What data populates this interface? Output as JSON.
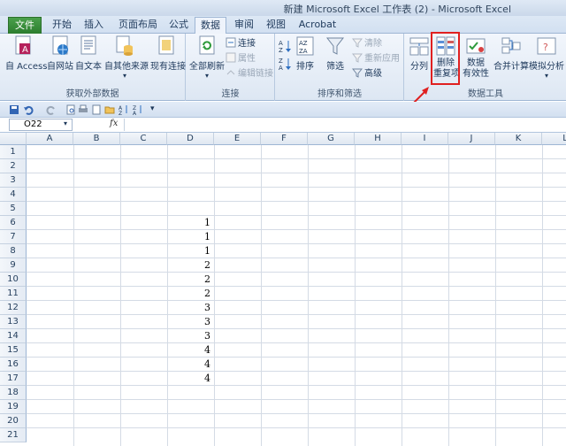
{
  "window": {
    "title": "新建 Microsoft Excel 工作表 (2) - Microsoft Excel"
  },
  "tabs": [
    "文件",
    "开始",
    "插入",
    "页面布局",
    "公式",
    "数据",
    "审阅",
    "视图",
    "Acrobat"
  ],
  "active_tab": "数据",
  "ribbon": {
    "get_external": {
      "label": "获取外部数据",
      "buttons": [
        "自 Access",
        "自网站",
        "自文本",
        "自其他来源",
        "现有连接"
      ]
    },
    "connections": {
      "label": "连接",
      "refresh": "全部刷新",
      "items": [
        "连接",
        "属性",
        "编辑链接"
      ]
    },
    "sort_filter": {
      "label": "排序和筛选",
      "sort": "排序",
      "filter": "筛选",
      "items": [
        "清除",
        "重新应用",
        "高级"
      ]
    },
    "data_tools": {
      "label": "数据工具",
      "split": "分列",
      "remove_dup_1": "删除",
      "remove_dup_2": "重复项",
      "validation_1": "数据",
      "validation_2": "有效性",
      "consolidate": "合并计算",
      "whatif": "模拟分析"
    }
  },
  "formula_bar": {
    "name_box": "O22",
    "fx": "fx",
    "formula": ""
  },
  "sheet": {
    "columns": [
      "A",
      "B",
      "C",
      "D",
      "E",
      "F",
      "G",
      "H",
      "I",
      "J",
      "K",
      "L"
    ],
    "rows": [
      "1",
      "2",
      "3",
      "4",
      "5",
      "6",
      "7",
      "8",
      "9",
      "10",
      "11",
      "12",
      "13",
      "14",
      "15",
      "16",
      "17",
      "18",
      "19",
      "20",
      "21"
    ],
    "column_d_values": [
      {
        "row": 6,
        "value": "1"
      },
      {
        "row": 7,
        "value": "1"
      },
      {
        "row": 8,
        "value": "1"
      },
      {
        "row": 9,
        "value": "2"
      },
      {
        "row": 10,
        "value": "2"
      },
      {
        "row": 11,
        "value": "2"
      },
      {
        "row": 12,
        "value": "3"
      },
      {
        "row": 13,
        "value": "3"
      },
      {
        "row": 14,
        "value": "3"
      },
      {
        "row": 15,
        "value": "4"
      },
      {
        "row": 16,
        "value": "4"
      },
      {
        "row": 17,
        "value": "4"
      }
    ]
  },
  "colors": {
    "file_tab": "#2c7d2e",
    "highlight": "#e02020",
    "ribbon_bg": "#dde7f3"
  }
}
